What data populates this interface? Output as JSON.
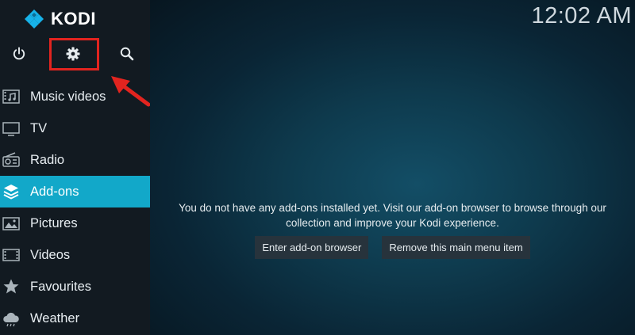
{
  "app": {
    "name": "KODI"
  },
  "clock": "12:02 AM",
  "top_icons": [
    {
      "name": "power-icon",
      "icon": "power"
    },
    {
      "name": "settings-icon",
      "icon": "gear"
    },
    {
      "name": "search-icon",
      "icon": "magnifier"
    }
  ],
  "menu": {
    "items": [
      {
        "label": "Music videos",
        "icon": "music-video"
      },
      {
        "label": "TV",
        "icon": "tv"
      },
      {
        "label": "Radio",
        "icon": "radio"
      },
      {
        "label": "Add-ons",
        "icon": "box",
        "active": true
      },
      {
        "label": "Pictures",
        "icon": "picture"
      },
      {
        "label": "Videos",
        "icon": "film"
      },
      {
        "label": "Favourites",
        "icon": "star"
      },
      {
        "label": "Weather",
        "icon": "cloud"
      }
    ]
  },
  "main": {
    "message_line1": "You do not have any add-ons installed yet. Visit our add-on browser to browse through our",
    "message_line2": "collection and improve your Kodi experience.",
    "enter_browser_label": "Enter add-on browser",
    "remove_item_label": "Remove this main menu item"
  },
  "colors": {
    "sidebar_bg": "#121a21",
    "active_item": "#12a8c9",
    "highlight": "#e2241f",
    "button_bg": "#27333c",
    "logo_blue": "#17b2e8"
  }
}
